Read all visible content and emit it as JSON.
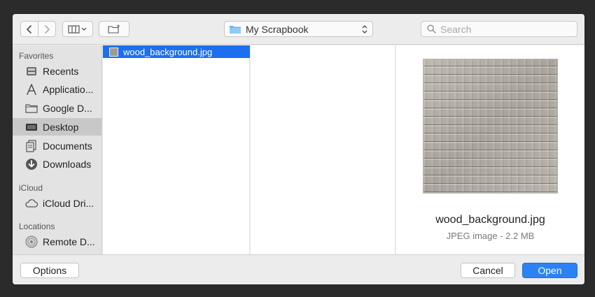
{
  "toolbar": {
    "back_icon": "chevron-left-icon",
    "forward_icon": "chevron-right-icon",
    "view_icon": "column-view-icon",
    "new_folder_icon": "new-folder-icon",
    "path_label": "My Scrapbook",
    "search_placeholder": "Search"
  },
  "sidebar": {
    "sections": [
      {
        "heading": "Favorites",
        "items": [
          {
            "label": "Recents",
            "icon": "clock-icon"
          },
          {
            "label": "Applicatio...",
            "icon": "applications-icon"
          },
          {
            "label": "Google D...",
            "icon": "folder-icon"
          },
          {
            "label": "Desktop",
            "icon": "desktop-icon",
            "selected": true
          },
          {
            "label": "Documents",
            "icon": "documents-icon"
          },
          {
            "label": "Downloads",
            "icon": "downloads-icon"
          }
        ]
      },
      {
        "heading": "iCloud",
        "items": [
          {
            "label": "iCloud Dri...",
            "icon": "cloud-icon"
          }
        ]
      },
      {
        "heading": "Locations",
        "items": [
          {
            "label": "Remote D...",
            "icon": "disc-icon"
          }
        ]
      }
    ]
  },
  "browser": {
    "files": [
      {
        "name": "wood_background.jpg",
        "selected": true
      }
    ]
  },
  "preview": {
    "name": "wood_background.jpg",
    "meta": "JPEG image - 2.2 MB"
  },
  "footer": {
    "options_label": "Options",
    "cancel_label": "Cancel",
    "open_label": "Open"
  },
  "colors": {
    "accent": "#2a82f5",
    "selection": "#1c6ff0",
    "sidebar_selected": "#c8c8c8"
  }
}
